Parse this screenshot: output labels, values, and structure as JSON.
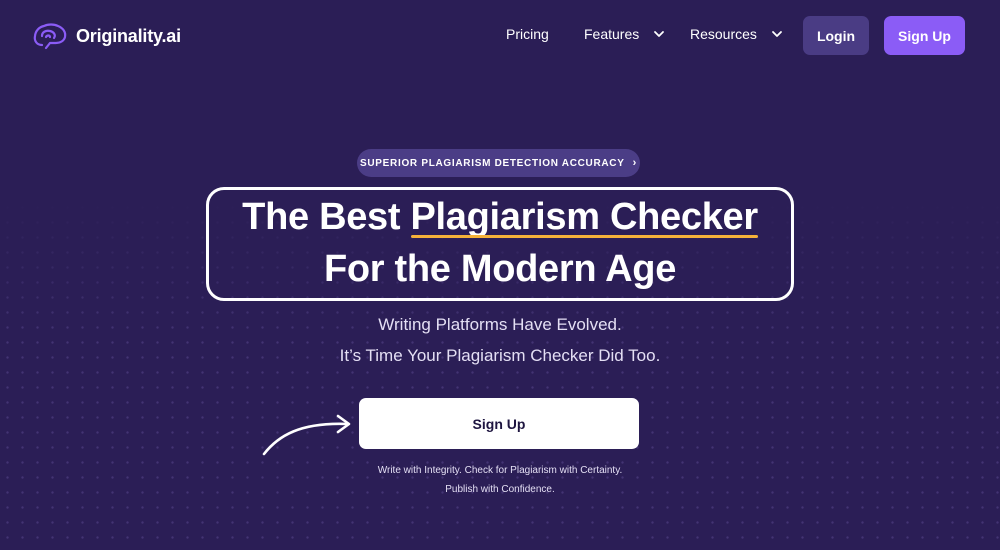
{
  "brand": {
    "name": "Originality.ai",
    "icon": "brain-icon"
  },
  "nav": {
    "links": [
      {
        "label": "Pricing",
        "has_dropdown": false
      },
      {
        "label": "Features",
        "has_dropdown": true
      },
      {
        "label": "Resources",
        "has_dropdown": true
      }
    ],
    "login_label": "Login",
    "signup_label": "Sign Up"
  },
  "hero": {
    "badge_label": "SUPERIOR PLAGIARISM DETECTION ACCURACY",
    "title_part_1": "The Best ",
    "title_highlight": "Plagiarism Checker",
    "title_line_2": "For the Modern Age",
    "subtitle_1": "Writing Platforms Have Evolved.",
    "subtitle_2": "It’s Time Your Plagiarism Checker Did Too.",
    "cta_label": "Sign Up",
    "tagline_1": "Write with Integrity. Check for Plagiarism with Certainty.",
    "tagline_2": "Publish with Confidence."
  },
  "colors": {
    "background": "#2b1e56",
    "accent": "#8b5cf6",
    "login_bg": "#4a3c84",
    "highlight_underline": "#f5b13a"
  }
}
